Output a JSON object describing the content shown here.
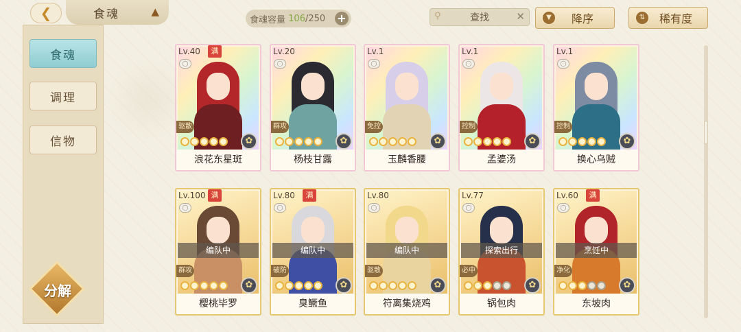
{
  "header": {
    "back_icon": "back-arrow-icon",
    "title": "食魂",
    "capacity_label": "食魂容量",
    "capacity_current": "106",
    "capacity_separator": "/250",
    "search_label": "查找",
    "sort_order_label": "降序",
    "sort_rarity_label": "稀有度"
  },
  "sidebar": {
    "items": [
      {
        "label": "食魂",
        "active": true
      },
      {
        "label": "调理",
        "active": false
      },
      {
        "label": "信物",
        "active": false
      }
    ],
    "decompose_label": "分解"
  },
  "cards": [
    {
      "level": "Lv.40",
      "max": "满",
      "role": "驱散",
      "name": "浪花东星斑",
      "stars": 5,
      "stars_on": 5,
      "status": "",
      "frame": "rainbow",
      "hair": "#b3262a",
      "outfit": "#6e1f22"
    },
    {
      "level": "Lv.20",
      "max": "",
      "role": "群攻",
      "name": "杨枝甘露",
      "stars": 5,
      "stars_on": 5,
      "status": "",
      "frame": "rainbow",
      "hair": "#2b2a30",
      "outfit": "#6ea3a2"
    },
    {
      "level": "Lv.1",
      "max": "",
      "role": "免控",
      "name": "玉麟香腰",
      "stars": 5,
      "stars_on": 5,
      "status": "",
      "frame": "rainbow",
      "hair": "#d7cfe9",
      "outfit": "#e2d3b4"
    },
    {
      "level": "Lv.1",
      "max": "",
      "role": "控制",
      "name": "孟婆汤",
      "stars": 5,
      "stars_on": 5,
      "status": "",
      "frame": "rainbow",
      "hair": "#ece7e6",
      "outfit": "#b4212b"
    },
    {
      "level": "Lv.1",
      "max": "",
      "role": "控制",
      "name": "换心乌贼",
      "stars": 5,
      "stars_on": 5,
      "status": "",
      "frame": "rainbow",
      "hair": "#7d8ca3",
      "outfit": "#2c6f86"
    },
    {
      "level": "Lv.100",
      "max": "满",
      "role": "群攻",
      "name": "樱桃毕罗",
      "stars": 5,
      "stars_on": 5,
      "status": "编队中",
      "frame": "gold",
      "hair": "#6b4a35",
      "outfit": "#c99066"
    },
    {
      "level": "Lv.80",
      "max": "满",
      "role": "破防",
      "name": "臭鳜鱼",
      "stars": 5,
      "stars_on": 5,
      "status": "编队中",
      "frame": "gold",
      "hair": "#d9d8dc",
      "outfit": "#3f4fa4"
    },
    {
      "level": "Lv.80",
      "max": "",
      "role": "驱散",
      "name": "符离集烧鸡",
      "stars": 5,
      "stars_on": 5,
      "status": "编队中",
      "frame": "gold",
      "hair": "#f2d88a",
      "outfit": "#e9d4a0"
    },
    {
      "level": "Lv.77",
      "max": "",
      "role": "必中",
      "name": "锅包肉",
      "stars": 5,
      "stars_on": 3,
      "status": "探索出行",
      "frame": "gold",
      "hair": "#27304a",
      "outfit": "#c8532e"
    },
    {
      "level": "Lv.60",
      "max": "满",
      "role": "净化",
      "name": "东坡肉",
      "stars": 5,
      "stars_on": 3,
      "status": "烹饪中",
      "frame": "gold",
      "hair": "#b0242a",
      "outfit": "#d77a2c"
    }
  ]
}
